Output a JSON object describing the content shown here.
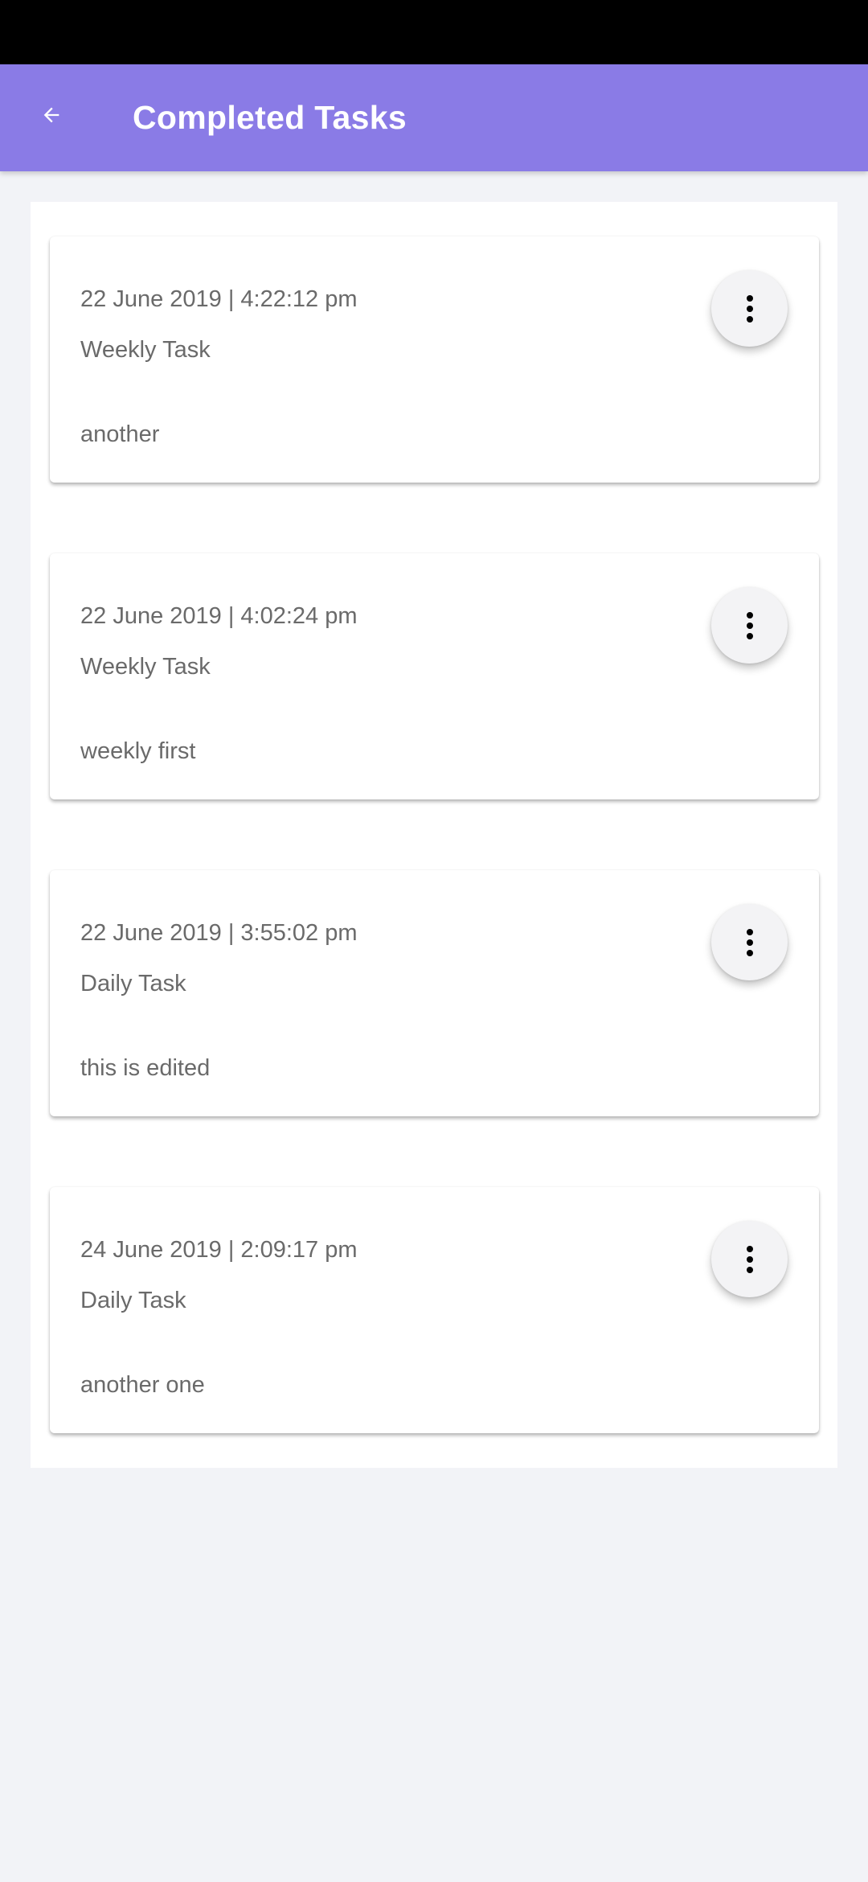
{
  "app_bar": {
    "title": "Completed Tasks",
    "back_icon": "arrow-left-icon",
    "color": "#8a7be6"
  },
  "tasks": [
    {
      "date": "22 June 2019 | 4:22:12 pm",
      "type": "Weekly Task",
      "name": "another",
      "menu_icon": "more-vert-icon"
    },
    {
      "date": "22 June 2019 | 4:02:24 pm",
      "type": "Weekly Task",
      "name": "weekly first",
      "menu_icon": "more-vert-icon"
    },
    {
      "date": "22 June 2019 | 3:55:02 pm",
      "type": "Daily Task",
      "name": "this is edited",
      "menu_icon": "more-vert-icon"
    },
    {
      "date": "24 June 2019 | 2:09:17 pm",
      "type": "Daily Task",
      "name": "another one",
      "menu_icon": "more-vert-icon"
    }
  ]
}
